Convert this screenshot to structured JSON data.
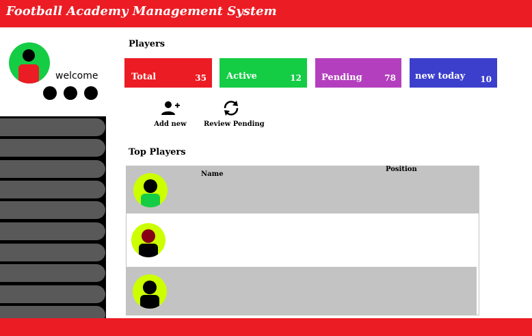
{
  "header": {
    "title": "Football Academy Management System",
    "background": "#ec1c24"
  },
  "profile": {
    "welcome": "welcome",
    "avatar_color": "#15cc45",
    "avatar_body_color": "#ec1c24"
  },
  "sidebar": {
    "item_count": 10
  },
  "players": {
    "title": "Players",
    "stats": [
      {
        "label": "Total",
        "value": "35",
        "color": "#ec1c24"
      },
      {
        "label": "Active",
        "value": "12",
        "color": "#15cc45"
      },
      {
        "label": "Pending",
        "value": "78",
        "color": "#b43fbe"
      },
      {
        "label": "new today",
        "value": "10",
        "color": "#3c3fcc"
      }
    ]
  },
  "actions": {
    "add_new": "Add new",
    "review_pending": "Review Pending"
  },
  "top_players": {
    "title": "Top Players",
    "columns": {
      "name": "Name",
      "position": "Position"
    },
    "rows": [
      {
        "avatar_head": "#000000",
        "avatar_body": "#15cc45",
        "background": "#c3c3c3"
      },
      {
        "avatar_head": "#880015",
        "avatar_body": "#000000",
        "background": "#ffffff"
      },
      {
        "avatar_head": "#000000",
        "avatar_body": "#000000",
        "background": "#c3c3c3"
      }
    ]
  }
}
